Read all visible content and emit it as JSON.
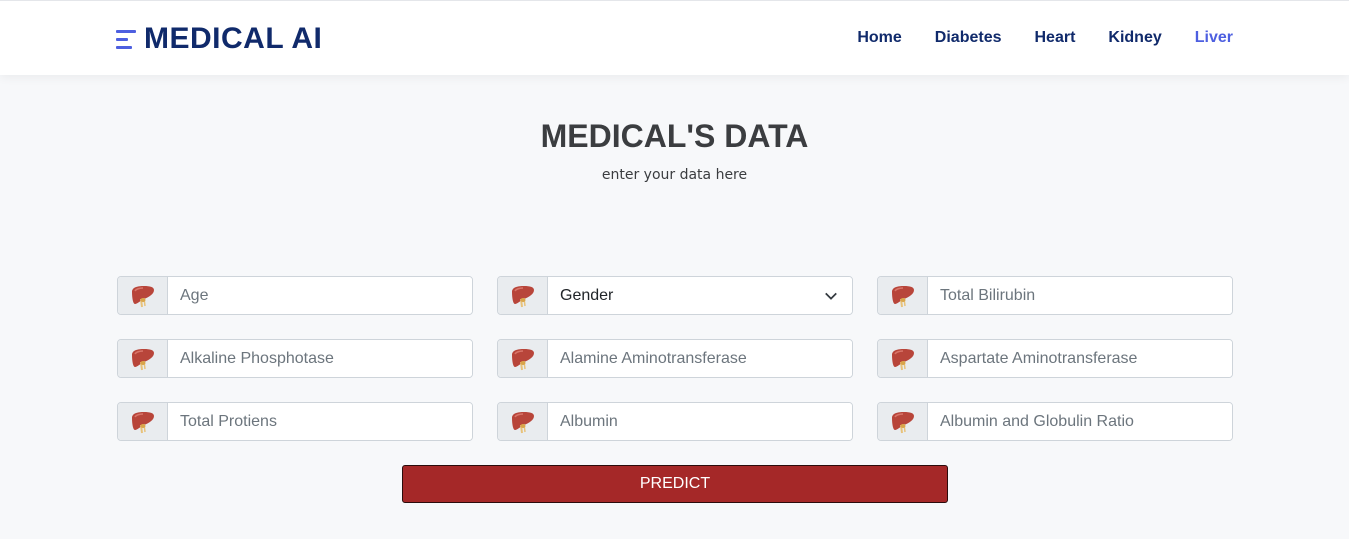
{
  "brand": {
    "name": "MEDICAL AI",
    "icon": "menu-lines-icon",
    "color": "#102a6b",
    "accent": "#4d5fe0"
  },
  "nav": {
    "items": [
      {
        "label": "Home",
        "active": false
      },
      {
        "label": "Diabetes",
        "active": false
      },
      {
        "label": "Heart",
        "active": false
      },
      {
        "label": "Kidney",
        "active": false
      },
      {
        "label": "Liver",
        "active": true
      }
    ]
  },
  "header": {
    "title": "MEDICAL'S DATA",
    "subtitle": "enter your data here"
  },
  "form": {
    "field_icon": "liver-icon",
    "fields": [
      {
        "placeholder": "Age",
        "type": "input"
      },
      {
        "value": "Gender",
        "type": "select"
      },
      {
        "placeholder": "Total Bilirubin",
        "type": "input"
      },
      {
        "placeholder": "Alkaline Phosphotase",
        "type": "input"
      },
      {
        "placeholder": "Alamine Aminotransferase",
        "type": "input"
      },
      {
        "placeholder": "Aspartate Aminotransferase",
        "type": "input"
      },
      {
        "placeholder": "Total Protiens",
        "type": "input"
      },
      {
        "placeholder": "Albumin",
        "type": "input"
      },
      {
        "placeholder": "Albumin and Globulin Ratio",
        "type": "input"
      }
    ],
    "submit_label": "PREDICT",
    "submit_color": "#a52828"
  }
}
